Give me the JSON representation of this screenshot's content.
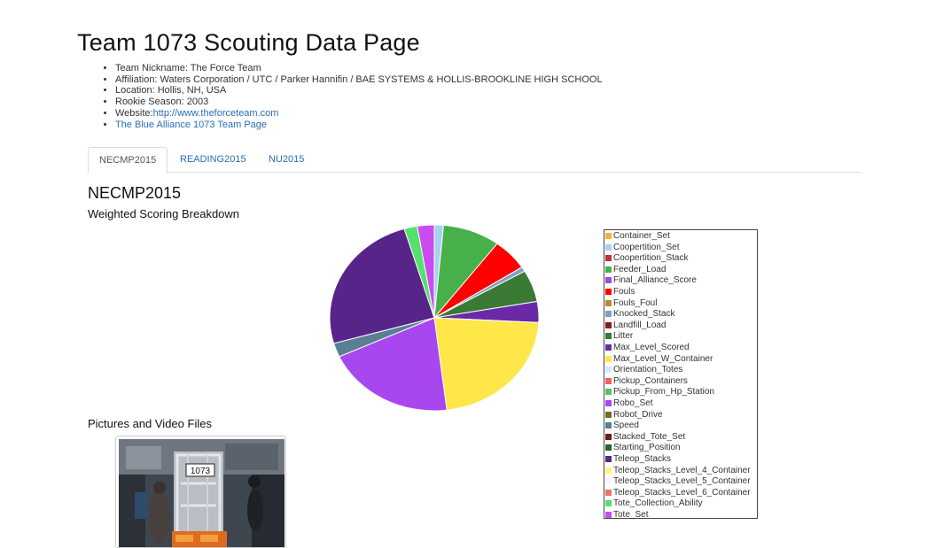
{
  "page": {
    "title": "Team 1073 Scouting Data Page"
  },
  "team_info": {
    "nickname": "Team Nickname: The Force Team",
    "affiliation": "Affiliation: Waters Corporation / UTC / Parker Hannifin / BAE SYSTEMS & HOLLIS-BROOKLINE HIGH SCHOOL",
    "location": "Location: Hollis, NH, USA",
    "rookie_season": "Rookie Season: 2003",
    "website_prefix": "Website:",
    "website_url": "http://www.theforceteam.com",
    "blue_alliance_link": "The Blue Alliance 1073 Team Page"
  },
  "tabs": [
    {
      "label": "NECMP2015",
      "active": true
    },
    {
      "label": "READING2015",
      "active": false
    },
    {
      "label": "NU2015",
      "active": false
    }
  ],
  "section": {
    "title": "NECMP2015",
    "chart_title": "Weighted Scoring Breakdown",
    "pictures_title": "Pictures and Video Files"
  },
  "photo": {
    "robot_number": "1073"
  },
  "chart_data": {
    "type": "pie",
    "title": "Weighted Scoring Breakdown",
    "legend_position": "right",
    "slices": [
      {
        "label": "Container_Set",
        "value": 0,
        "color": "#f5b33d"
      },
      {
        "label": "Coopertition_Set",
        "value": 1.4,
        "color": "#a8d0f0"
      },
      {
        "label": "Coopertition_Stack",
        "value": 0,
        "color": "#c0303a"
      },
      {
        "label": "Feeder_Load",
        "value": 8.8,
        "color": "#47b04b"
      },
      {
        "label": "Final_Alliance_Score",
        "value": 0,
        "color": "#9b4ee0"
      },
      {
        "label": "Fouls",
        "value": 5.5,
        "color": "#ff0000"
      },
      {
        "label": "Fouls_Foul",
        "value": 0,
        "color": "#b09020"
      },
      {
        "label": "Knocked_Stack",
        "value": 0.8,
        "color": "#7fa0c0"
      },
      {
        "label": "Landfill_Load",
        "value": 0,
        "color": "#8b1a1a"
      },
      {
        "label": "Litter",
        "value": 5.5,
        "color": "#3a7a35"
      },
      {
        "label": "Max_Level_Scored",
        "value": 3.6,
        "color": "#6a2aa8"
      },
      {
        "label": "Max_Level_W_Container",
        "value": 22.1,
        "color": "#ffe74a"
      },
      {
        "label": "Orientation_Totes",
        "value": 0,
        "color": "#d0ecf8"
      },
      {
        "label": "Pickup_Containers",
        "value": 0,
        "color": "#f06060"
      },
      {
        "label": "Pickup_From_Hp_Station",
        "value": 0,
        "color": "#5cc060"
      },
      {
        "label": "Robo_Set",
        "value": 19.9,
        "color": "#a846f0"
      },
      {
        "label": "Robot_Drive",
        "value": 0,
        "color": "#7a6a20"
      },
      {
        "label": "Speed",
        "value": 2.4,
        "color": "#5a7f94"
      },
      {
        "label": "Stacked_Tote_Set",
        "value": 0,
        "color": "#6a1a1a"
      },
      {
        "label": "Starting_Position",
        "value": 0,
        "color": "#2f5e2f"
      },
      {
        "label": "Teleop_Stacks",
        "value": 24.6,
        "color": "#57248a"
      },
      {
        "label": "Teleop_Stacks_Level_4_Container",
        "value": 0,
        "color": "#fff27a"
      },
      {
        "label": "Teleop_Stacks_Level_5_Container",
        "value": 0,
        "color": "#f4faff"
      },
      {
        "label": "Teleop_Stacks_Level_6_Container",
        "value": 0,
        "color": "#f07070"
      },
      {
        "label": "Tote_Collection_Ability",
        "value": 2.0,
        "color": "#56e06a"
      },
      {
        "label": "Tote_Set",
        "value": 2.6,
        "color": "#c84cf0"
      }
    ]
  }
}
